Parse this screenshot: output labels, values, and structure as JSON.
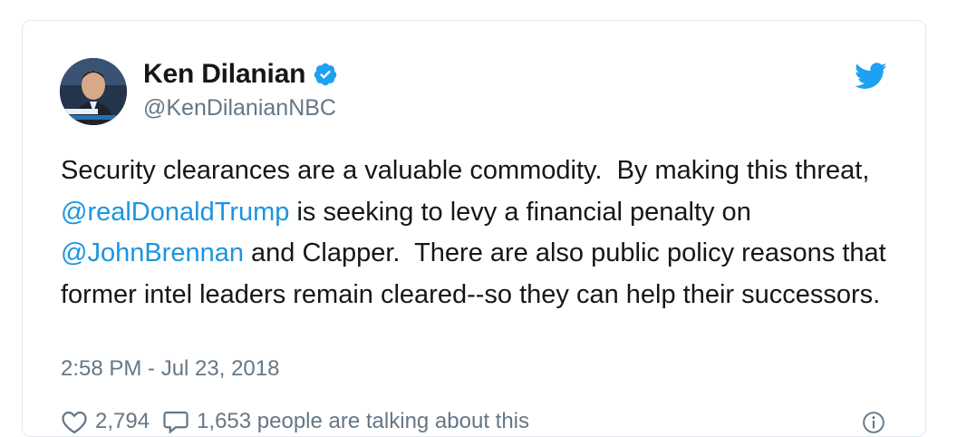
{
  "author": {
    "display_name": "Ken Dilanian",
    "handle": "@KenDilanianNBC",
    "verified": true,
    "avatar_icon": "avatar-photo"
  },
  "tweet": {
    "text_parts": [
      "Security clearances are a valuable commodity.  By making this threat, ",
      "@realDonaldTrump",
      " is seeking to levy a financial penalty on ",
      "@JohnBrennan",
      " and Clapper.  There are also public policy reasons that former intel leaders remain cleared--so they can help their successors."
    ],
    "timestamp": "2:58 PM - Jul 23, 2018"
  },
  "actions": {
    "likes": "2,794",
    "replies_label": "1,653 people are talking about this"
  },
  "colors": {
    "link": "#1b95e0",
    "secondary": "#657786",
    "text": "#14171a",
    "border": "#e1e8ed",
    "verified": "#1da1f2"
  }
}
